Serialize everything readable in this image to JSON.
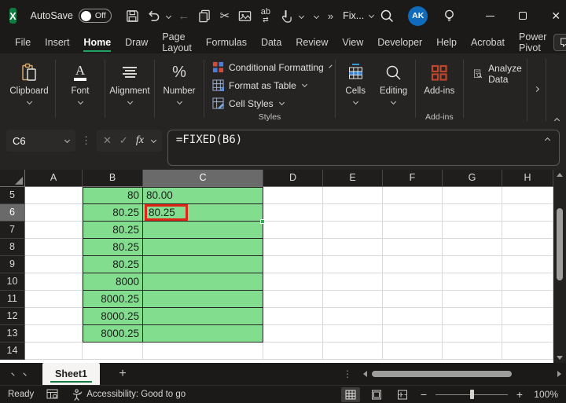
{
  "titlebar": {
    "autosave_label": "AutoSave",
    "autosave_state": "Off",
    "filename": "Fix...",
    "avatar_initials": "AK",
    "overflow_glyph": "»",
    "quick_access_icons": [
      "save-icon",
      "undo-icon",
      "back-arrow-icon",
      "copy-icon",
      "cut-icon",
      "picture-icon",
      "replace-icon",
      "touch-icon"
    ]
  },
  "menubar": {
    "items": [
      "File",
      "Insert",
      "Home",
      "Draw",
      "Page Layout",
      "Formulas",
      "Data",
      "Review",
      "View",
      "Developer",
      "Help",
      "Acrobat",
      "Power Pivot"
    ],
    "active": "Home"
  },
  "ribbon": {
    "collapsed_groups": [
      {
        "label": "Clipboard",
        "icon": "clipboard-icon"
      },
      {
        "label": "Font",
        "icon": "font-icon"
      },
      {
        "label": "Alignment",
        "icon": "alignment-icon"
      },
      {
        "label": "Number",
        "icon": "number-icon"
      }
    ],
    "styles_group": {
      "buttons": [
        {
          "label": "Conditional Formatting",
          "icon": "conditional-formatting-icon"
        },
        {
          "label": "Format as Table",
          "icon": "format-as-table-icon"
        },
        {
          "label": "Cell Styles",
          "icon": "cell-styles-icon"
        }
      ],
      "group_label": "Styles"
    },
    "cells_group_label": "Cells",
    "editing_group_label": "Editing",
    "addins_button_label": "Add-ins",
    "addins_group_label": "Add-ins",
    "analyze_data_label": "Analyze Data"
  },
  "formula_bar": {
    "name_box_value": "C6",
    "fx_label": "fx",
    "formula": "=FIXED(B6)"
  },
  "grid": {
    "column_headers": [
      "A",
      "B",
      "C",
      "D",
      "E",
      "F",
      "G",
      "H"
    ],
    "selected_column": "C",
    "selected_row": 6,
    "selected_cell": "C6",
    "rows": [
      {
        "n": 5,
        "B": "80",
        "C": "80.00",
        "fill": true
      },
      {
        "n": 6,
        "B": "80.25",
        "C": "80.25",
        "fill": true,
        "annotated": true
      },
      {
        "n": 7,
        "B": "80.25",
        "C": "",
        "fill": true
      },
      {
        "n": 8,
        "B": "80.25",
        "C": "",
        "fill": true
      },
      {
        "n": 9,
        "B": "80.25",
        "C": "",
        "fill": true
      },
      {
        "n": 10,
        "B": "8000",
        "C": "",
        "fill": true
      },
      {
        "n": 11,
        "B": "8000.25",
        "C": "",
        "fill": true
      },
      {
        "n": 12,
        "B": "8000.25",
        "C": "",
        "fill": true
      },
      {
        "n": 13,
        "B": "8000.25",
        "C": "",
        "fill": true
      },
      {
        "n": 14,
        "B": "",
        "C": "",
        "fill": false
      }
    ]
  },
  "sheet_bar": {
    "tabs": [
      "Sheet1"
    ],
    "active_tab": "Sheet1",
    "add_sheet_glyph": "+"
  },
  "status_bar": {
    "mode": "Ready",
    "accessibility_text": "Accessibility: Good to go",
    "zoom_level": "100%"
  },
  "colors": {
    "cell_fill_green": "#82DE8E",
    "annotation_red": "#E02518",
    "accent_green": "#21A366",
    "avatar_blue": "#0F6CBD",
    "share_button_green": "#3FA05F"
  }
}
